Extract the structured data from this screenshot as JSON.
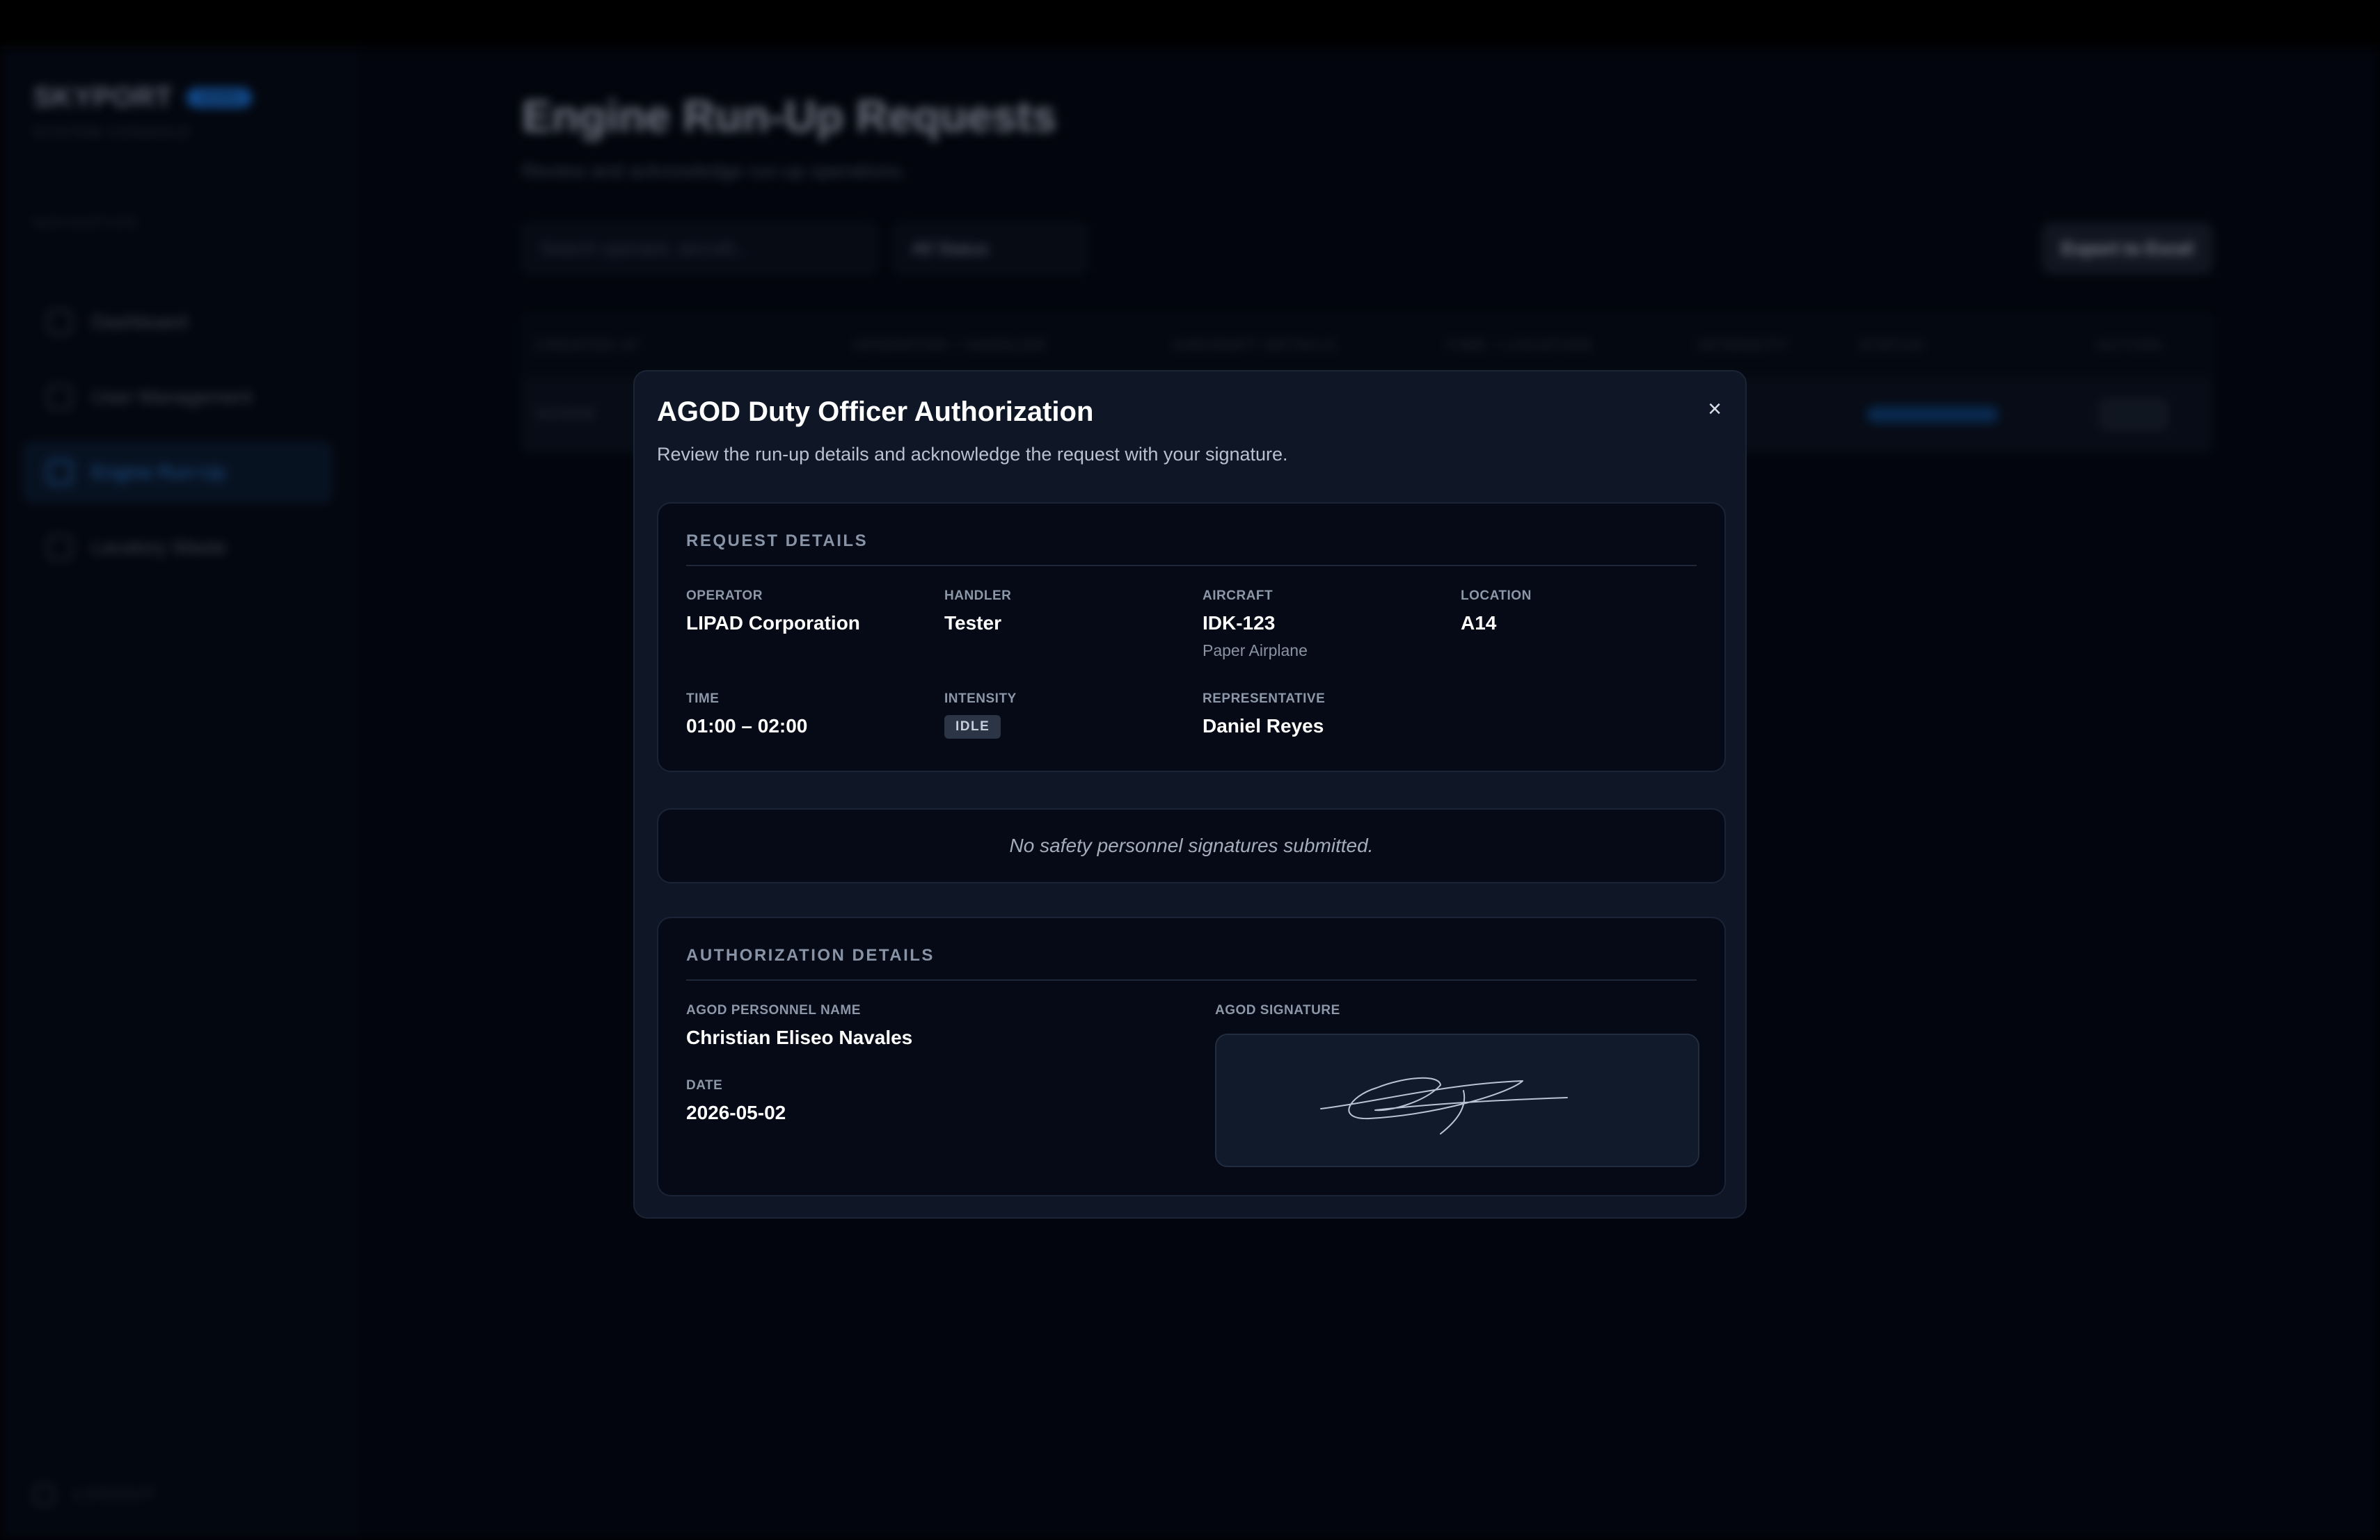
{
  "background": {
    "brand": {
      "name": "SKYPORT",
      "badge": "ADMIN",
      "subtitle": "SYSTEM CONSOLE"
    },
    "nav_heading": "NAVIGATION",
    "nav": [
      {
        "label": "Dashboard",
        "icon": "dashboard-icon"
      },
      {
        "label": "User Management",
        "icon": "user-icon"
      },
      {
        "label": "Engine Run-Up",
        "icon": "plane-icon",
        "active": true
      },
      {
        "label": "Lavatory Waste",
        "icon": "bin-icon"
      }
    ],
    "logout": "LOGOUT",
    "page_title": "Engine Run-Up Requests",
    "page_subtitle": "Review and acknowledge run-up operations.",
    "search_placeholder": "Search operator, aircraft...",
    "status_filter": "All Status",
    "export_label": "Export to Excel",
    "table_headers": [
      "CREATED AT",
      "OPERATOR / HANDLER",
      "AIRCRAFT DETAILS",
      "TIME / LOCATION",
      "INTENSITY",
      "STATUS",
      "ACTION"
    ],
    "row": {
      "created": "5/2/2026"
    }
  },
  "modal": {
    "title": "AGOD Duty Officer Authorization",
    "subtitle": "Review the run-up details and acknowledge the request with your signature.",
    "close_icon": "close-icon",
    "request": {
      "heading": "REQUEST DETAILS",
      "operator": {
        "label": "OPERATOR",
        "value": "LIPAD Corporation"
      },
      "handler": {
        "label": "HANDLER",
        "value": "Tester"
      },
      "aircraft": {
        "label": "AIRCRAFT",
        "value": "IDK-123",
        "note": "Paper Airplane"
      },
      "location": {
        "label": "LOCATION",
        "value": "A14"
      },
      "time": {
        "label": "TIME",
        "value": "01:00 – 02:00"
      },
      "intensity": {
        "label": "INTENSITY",
        "value": "IDLE"
      },
      "representative": {
        "label": "REPRESENTATIVE",
        "value": "Daniel Reyes"
      }
    },
    "safety_empty": "No safety personnel signatures submitted.",
    "authorization": {
      "heading": "AUTHORIZATION DETAILS",
      "name": {
        "label": "AGOD PERSONNEL NAME",
        "value": "Christian Eliseo Navales"
      },
      "date": {
        "label": "DATE",
        "value": "2026-05-02"
      },
      "signature": {
        "label": "AGOD SIGNATURE"
      }
    }
  },
  "colors": {
    "modal_bg": "#0f1726",
    "card_bg": "#050a16",
    "accent": "#2f7fd8",
    "signature_stroke": "#b9c4d2"
  }
}
